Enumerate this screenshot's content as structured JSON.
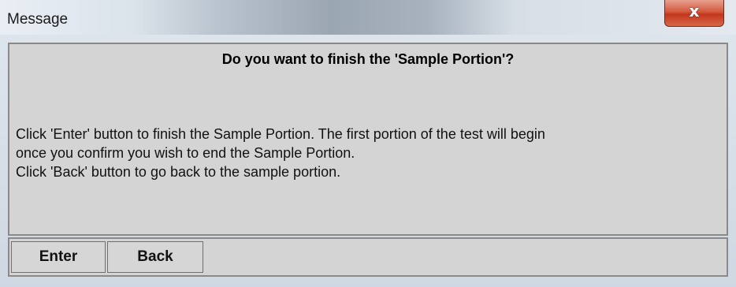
{
  "window": {
    "title": "Message",
    "close_symbol": "x"
  },
  "dialog": {
    "heading": "Do you want to finish the 'Sample Portion'?",
    "body_lines": [
      "Click 'Enter' button to finish the Sample Portion. The first portion of the test will begin",
      "once you confirm you wish to end the Sample Portion.",
      "Click 'Back' button to go back to the sample portion."
    ]
  },
  "buttons": {
    "enter_label": "Enter",
    "back_label": "Back"
  },
  "colors": {
    "panel_background": "#d4d4d4",
    "close_button": "#c2371c"
  }
}
